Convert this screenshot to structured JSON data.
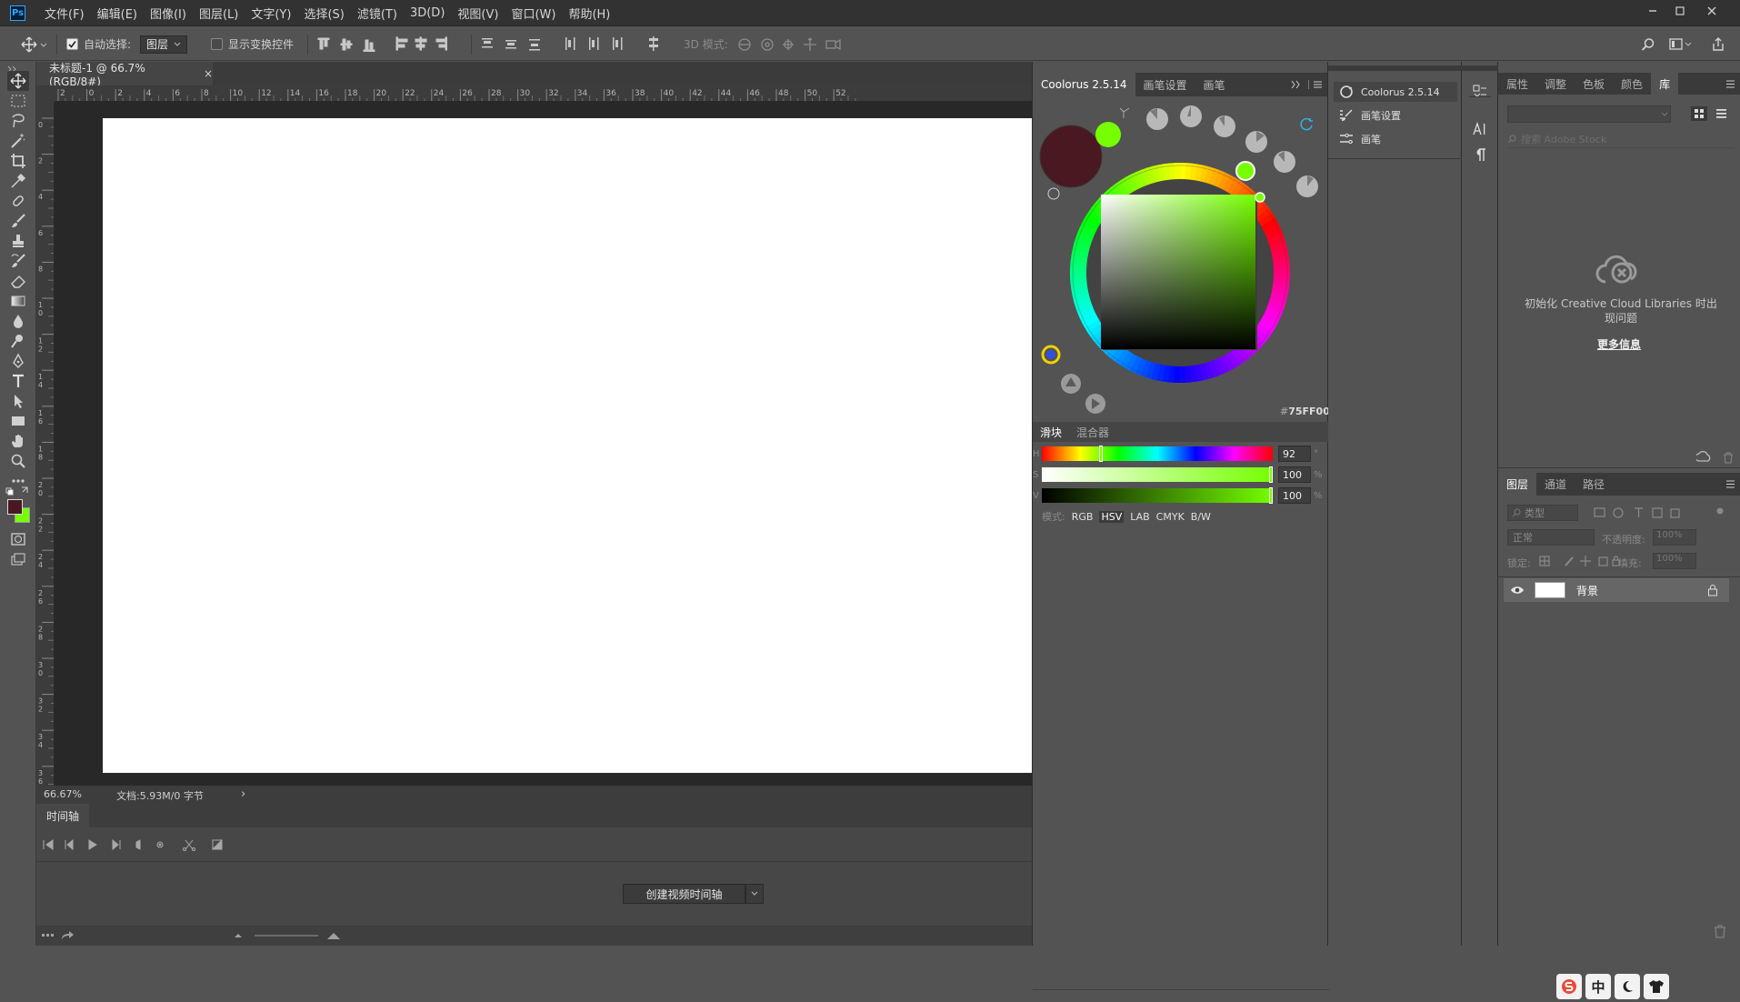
{
  "app": {
    "logo": "Ps"
  },
  "menu": [
    "文件(F)",
    "编辑(E)",
    "图像(I)",
    "图层(L)",
    "文字(Y)",
    "选择(S)",
    "滤镜(T)",
    "3D(D)",
    "视图(V)",
    "窗口(W)",
    "帮助(H)"
  ],
  "options": {
    "auto_select_label": "自动选择:",
    "auto_select_value": "图层",
    "show_transform_label": "显示变换控件",
    "mode_3d_label": "3D 模式:"
  },
  "document": {
    "tab_title": "未标题-1 @ 66.7%(RGB/8#)",
    "close": "×"
  },
  "ruler": {
    "top_ticks": [
      "2",
      "0",
      "2",
      "4",
      "6",
      "8",
      "10",
      "12",
      "14",
      "16",
      "18",
      "20",
      "22",
      "24",
      "26",
      "28",
      "30",
      "32",
      "34",
      "36",
      "38",
      "40",
      "42",
      "44",
      "46",
      "48",
      "50",
      "52"
    ],
    "left_ticks": [
      "0",
      "2",
      "4",
      "6",
      "8",
      "10",
      "12",
      "14",
      "16",
      "18",
      "20",
      "22",
      "24",
      "26",
      "28",
      "30",
      "32",
      "34",
      "36"
    ]
  },
  "status": {
    "zoom": "66.67%",
    "doc_info": "文档:5.93M/0 字节",
    "arrow": "›"
  },
  "timeline": {
    "tab": "时间轴",
    "create_button": "创建视频时间轴"
  },
  "coolorus": {
    "tabs": [
      "Coolorus 2.5.14",
      "画笔设置",
      "画笔"
    ],
    "hex_prefix": "#",
    "hex": "75FF00",
    "foreground": "#4a1820",
    "background": "#75ff00",
    "sub_tabs": [
      "滑块",
      "混合器"
    ],
    "sliders": [
      {
        "label": "H",
        "value": "92",
        "unit": "°",
        "level": 0.256
      },
      {
        "label": "S",
        "value": "100",
        "unit": "%",
        "level": 1.0
      },
      {
        "label": "V",
        "value": "100",
        "unit": "%",
        "level": 1.0
      }
    ],
    "mode_label": "模式:",
    "modes": [
      "RGB",
      "HSV",
      "LAB",
      "CMYK",
      "B/W"
    ]
  },
  "midpanel": {
    "items": [
      "Coolorus 2.5.14",
      "画笔设置",
      "画笔"
    ]
  },
  "library": {
    "tabs": [
      "属性",
      "调整",
      "色板",
      "颜色",
      "库"
    ],
    "search_placeholder": "搜索 Adobe Stock",
    "error_text": "初始化 Creative Cloud Libraries 时出现问题",
    "more_info": "更多信息"
  },
  "layers": {
    "tabs": [
      "图层",
      "通道",
      "路径"
    ],
    "filter_label": "类型",
    "blend_mode": "正常",
    "opacity_label": "不透明度:",
    "opacity": "100%",
    "lock_label": "锁定:",
    "fill_label": "填充:",
    "fill": "100%",
    "rows": [
      {
        "name": "背景"
      }
    ]
  },
  "ime": {
    "items": [
      "中"
    ]
  }
}
